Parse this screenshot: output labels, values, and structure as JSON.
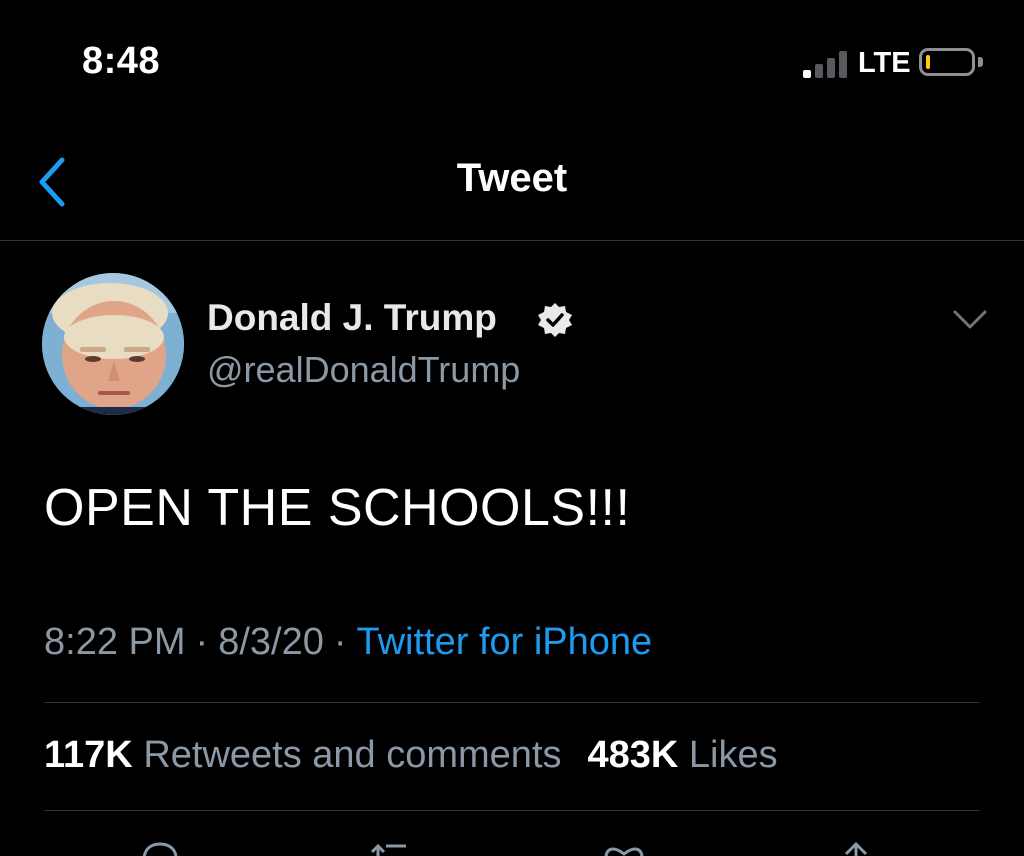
{
  "status_bar": {
    "time": "8:48",
    "network": "LTE",
    "signal_bars_active": 1,
    "signal_bars_total": 4,
    "battery_level": 0.1,
    "battery_color": "#ffcc00"
  },
  "nav": {
    "back_icon": "chevron-left-icon",
    "title": "Tweet"
  },
  "author": {
    "name": "Donald J. Trump",
    "handle": "@realDonaldTrump",
    "verified": true,
    "verified_icon": "verified-badge-icon",
    "menu_icon": "chevron-down-icon"
  },
  "tweet": {
    "text": "OPEN THE SCHOOLS!!!",
    "time": "8:22 PM",
    "separator": "·",
    "date": "8/3/20",
    "source": "Twitter for iPhone"
  },
  "stats": {
    "retweets_count": "117K",
    "retweets_label": "Retweets and comments",
    "likes_count": "483K",
    "likes_label": "Likes"
  },
  "actions": [
    "reply-icon",
    "retweet-icon",
    "like-icon",
    "share-icon"
  ],
  "colors": {
    "background": "#000000",
    "link": "#1d9bf0",
    "secondary_text": "#8b98a5",
    "divider": "#2f3336",
    "back_chevron": "#1d9bf0"
  }
}
